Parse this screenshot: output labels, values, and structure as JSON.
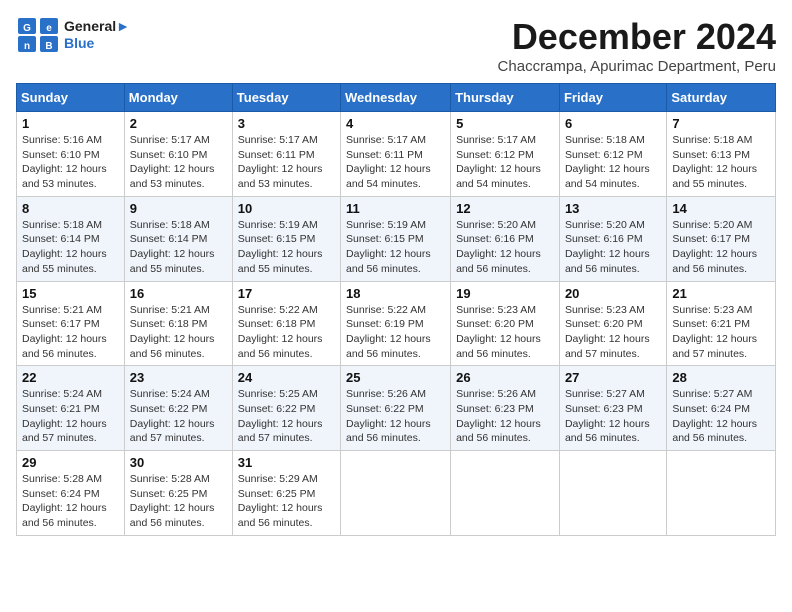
{
  "header": {
    "logo_general": "General",
    "logo_blue": "Blue",
    "month_title": "December 2024",
    "subtitle": "Chaccrampa, Apurimac Department, Peru"
  },
  "weekdays": [
    "Sunday",
    "Monday",
    "Tuesday",
    "Wednesday",
    "Thursday",
    "Friday",
    "Saturday"
  ],
  "weeks": [
    [
      {
        "day": "1",
        "info": "Sunrise: 5:16 AM\nSunset: 6:10 PM\nDaylight: 12 hours\nand 53 minutes."
      },
      {
        "day": "2",
        "info": "Sunrise: 5:17 AM\nSunset: 6:10 PM\nDaylight: 12 hours\nand 53 minutes."
      },
      {
        "day": "3",
        "info": "Sunrise: 5:17 AM\nSunset: 6:11 PM\nDaylight: 12 hours\nand 53 minutes."
      },
      {
        "day": "4",
        "info": "Sunrise: 5:17 AM\nSunset: 6:11 PM\nDaylight: 12 hours\nand 54 minutes."
      },
      {
        "day": "5",
        "info": "Sunrise: 5:17 AM\nSunset: 6:12 PM\nDaylight: 12 hours\nand 54 minutes."
      },
      {
        "day": "6",
        "info": "Sunrise: 5:18 AM\nSunset: 6:12 PM\nDaylight: 12 hours\nand 54 minutes."
      },
      {
        "day": "7",
        "info": "Sunrise: 5:18 AM\nSunset: 6:13 PM\nDaylight: 12 hours\nand 55 minutes."
      }
    ],
    [
      {
        "day": "8",
        "info": "Sunrise: 5:18 AM\nSunset: 6:14 PM\nDaylight: 12 hours\nand 55 minutes."
      },
      {
        "day": "9",
        "info": "Sunrise: 5:18 AM\nSunset: 6:14 PM\nDaylight: 12 hours\nand 55 minutes."
      },
      {
        "day": "10",
        "info": "Sunrise: 5:19 AM\nSunset: 6:15 PM\nDaylight: 12 hours\nand 55 minutes."
      },
      {
        "day": "11",
        "info": "Sunrise: 5:19 AM\nSunset: 6:15 PM\nDaylight: 12 hours\nand 56 minutes."
      },
      {
        "day": "12",
        "info": "Sunrise: 5:20 AM\nSunset: 6:16 PM\nDaylight: 12 hours\nand 56 minutes."
      },
      {
        "day": "13",
        "info": "Sunrise: 5:20 AM\nSunset: 6:16 PM\nDaylight: 12 hours\nand 56 minutes."
      },
      {
        "day": "14",
        "info": "Sunrise: 5:20 AM\nSunset: 6:17 PM\nDaylight: 12 hours\nand 56 minutes."
      }
    ],
    [
      {
        "day": "15",
        "info": "Sunrise: 5:21 AM\nSunset: 6:17 PM\nDaylight: 12 hours\nand 56 minutes."
      },
      {
        "day": "16",
        "info": "Sunrise: 5:21 AM\nSunset: 6:18 PM\nDaylight: 12 hours\nand 56 minutes."
      },
      {
        "day": "17",
        "info": "Sunrise: 5:22 AM\nSunset: 6:18 PM\nDaylight: 12 hours\nand 56 minutes."
      },
      {
        "day": "18",
        "info": "Sunrise: 5:22 AM\nSunset: 6:19 PM\nDaylight: 12 hours\nand 56 minutes."
      },
      {
        "day": "19",
        "info": "Sunrise: 5:23 AM\nSunset: 6:20 PM\nDaylight: 12 hours\nand 56 minutes."
      },
      {
        "day": "20",
        "info": "Sunrise: 5:23 AM\nSunset: 6:20 PM\nDaylight: 12 hours\nand 57 minutes."
      },
      {
        "day": "21",
        "info": "Sunrise: 5:23 AM\nSunset: 6:21 PM\nDaylight: 12 hours\nand 57 minutes."
      }
    ],
    [
      {
        "day": "22",
        "info": "Sunrise: 5:24 AM\nSunset: 6:21 PM\nDaylight: 12 hours\nand 57 minutes."
      },
      {
        "day": "23",
        "info": "Sunrise: 5:24 AM\nSunset: 6:22 PM\nDaylight: 12 hours\nand 57 minutes."
      },
      {
        "day": "24",
        "info": "Sunrise: 5:25 AM\nSunset: 6:22 PM\nDaylight: 12 hours\nand 57 minutes."
      },
      {
        "day": "25",
        "info": "Sunrise: 5:26 AM\nSunset: 6:22 PM\nDaylight: 12 hours\nand 56 minutes."
      },
      {
        "day": "26",
        "info": "Sunrise: 5:26 AM\nSunset: 6:23 PM\nDaylight: 12 hours\nand 56 minutes."
      },
      {
        "day": "27",
        "info": "Sunrise: 5:27 AM\nSunset: 6:23 PM\nDaylight: 12 hours\nand 56 minutes."
      },
      {
        "day": "28",
        "info": "Sunrise: 5:27 AM\nSunset: 6:24 PM\nDaylight: 12 hours\nand 56 minutes."
      }
    ],
    [
      {
        "day": "29",
        "info": "Sunrise: 5:28 AM\nSunset: 6:24 PM\nDaylight: 12 hours\nand 56 minutes."
      },
      {
        "day": "30",
        "info": "Sunrise: 5:28 AM\nSunset: 6:25 PM\nDaylight: 12 hours\nand 56 minutes."
      },
      {
        "day": "31",
        "info": "Sunrise: 5:29 AM\nSunset: 6:25 PM\nDaylight: 12 hours\nand 56 minutes."
      },
      {
        "day": "",
        "info": ""
      },
      {
        "day": "",
        "info": ""
      },
      {
        "day": "",
        "info": ""
      },
      {
        "day": "",
        "info": ""
      }
    ]
  ]
}
